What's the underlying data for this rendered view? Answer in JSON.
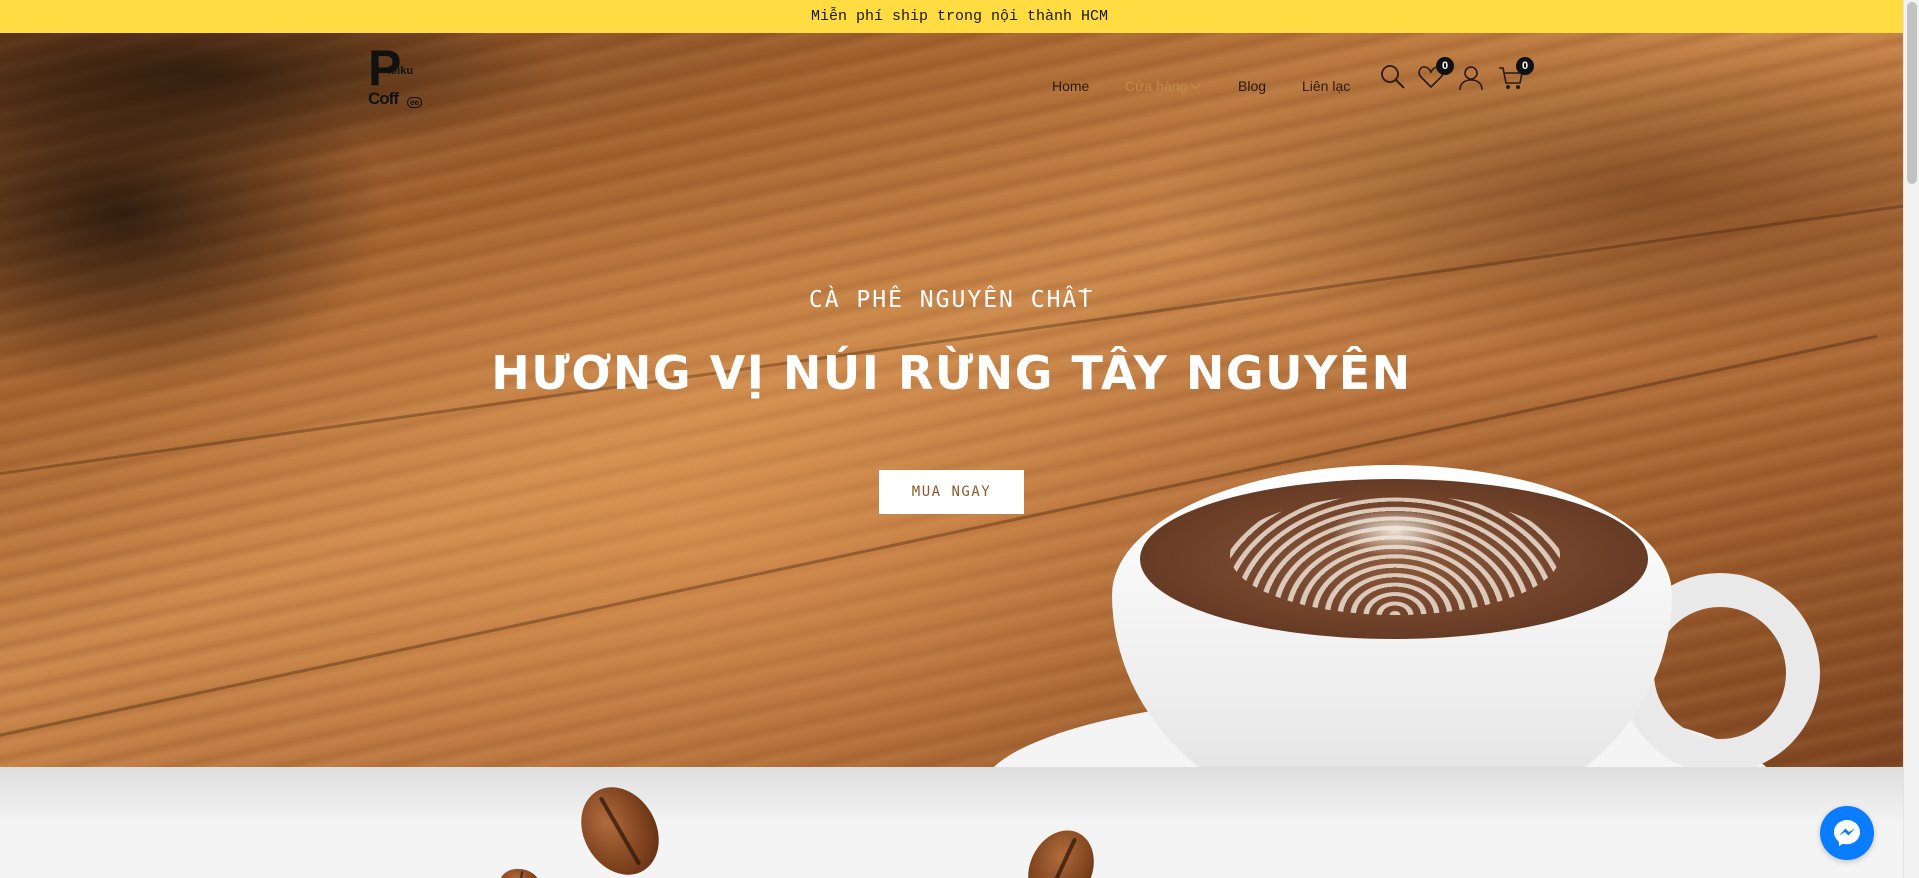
{
  "announcement": {
    "text": "Miễn phí ship trong nội thành HCM"
  },
  "logo": {
    "letter": "P",
    "line1": "leiku",
    "line2": "Coff",
    "mark": "ee"
  },
  "nav": {
    "items": [
      {
        "label": "Home",
        "active": false
      },
      {
        "label": "Cửa hàng",
        "active": true,
        "has_dropdown": true
      },
      {
        "label": "Blog",
        "active": false
      },
      {
        "label": "Liên lạc",
        "active": false
      }
    ]
  },
  "header_icons": {
    "search": {
      "icon": "search-icon"
    },
    "wishlist": {
      "icon": "heart-icon",
      "count": "0"
    },
    "account": {
      "icon": "user-icon"
    },
    "cart": {
      "icon": "cart-icon",
      "count": "0"
    }
  },
  "hero": {
    "subtitle": "CÀ PHÊ NGUYÊN CHẤT",
    "title": "HƯƠNG VỊ NÚI RỪNG TÂY NGUYÊN",
    "cta_label": "MUA NGAY"
  },
  "chat": {
    "icon": "messenger-icon"
  },
  "colors": {
    "announcement_bg": "#ffdc41",
    "active_nav": "#c58a4a",
    "cta_text": "#8a5a2e",
    "messenger": "#0a7cff"
  }
}
